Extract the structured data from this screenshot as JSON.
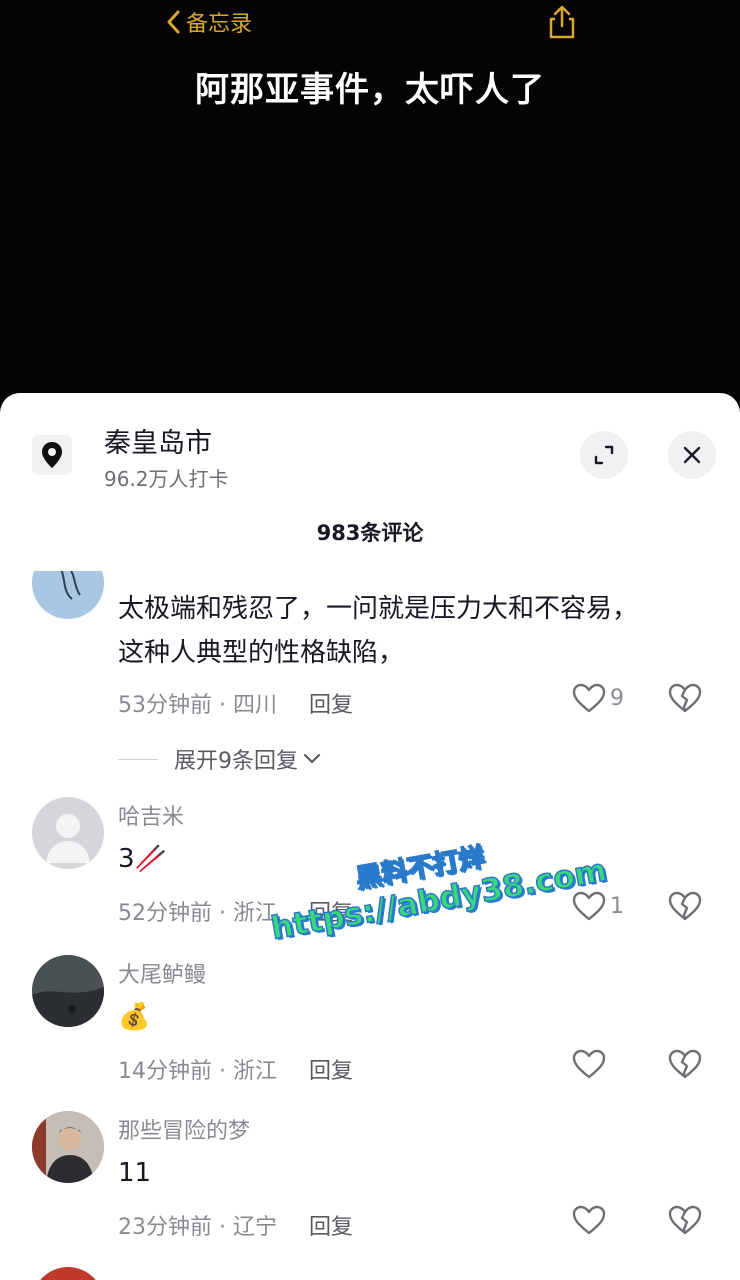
{
  "nav": {
    "back_label": "备忘录"
  },
  "video": {
    "title": "阿那亚事件，太吓人了"
  },
  "location": {
    "name": "秦皇岛市",
    "checkins": "96.2万人打卡"
  },
  "comments_header": "983条评论",
  "comments": [
    {
      "username": "",
      "text_line1": "太极端和残忍了，一问就是压力大和不容易，",
      "text_line2": "这种人典型的性格缺陷，",
      "time": "53分钟前 · 四川",
      "reply_label": "回复",
      "likes": "9",
      "expand_label": "展开9条回复"
    },
    {
      "username": "哈吉米",
      "text": "3🥢",
      "time": "52分钟前 · 浙江",
      "reply_label": "回复",
      "likes": "1"
    },
    {
      "username": "大尾鲈鳗",
      "text": "💰",
      "time": "14分钟前 · 浙江",
      "reply_label": "回复",
      "likes": ""
    },
    {
      "username": "那些冒险的梦",
      "text": "11",
      "time": "23分钟前 · 辽宁",
      "reply_label": "回复",
      "likes": ""
    }
  ],
  "watermark": {
    "line1": "黑料不打烊",
    "line2": "https://abdy38.com"
  },
  "colors": {
    "accent": "#d9a62e",
    "sheet_bg": "#ffffff",
    "muted_text": "#8a8b91",
    "watermark_fill": "#39d97a",
    "watermark_stroke": "#2a7acb"
  }
}
